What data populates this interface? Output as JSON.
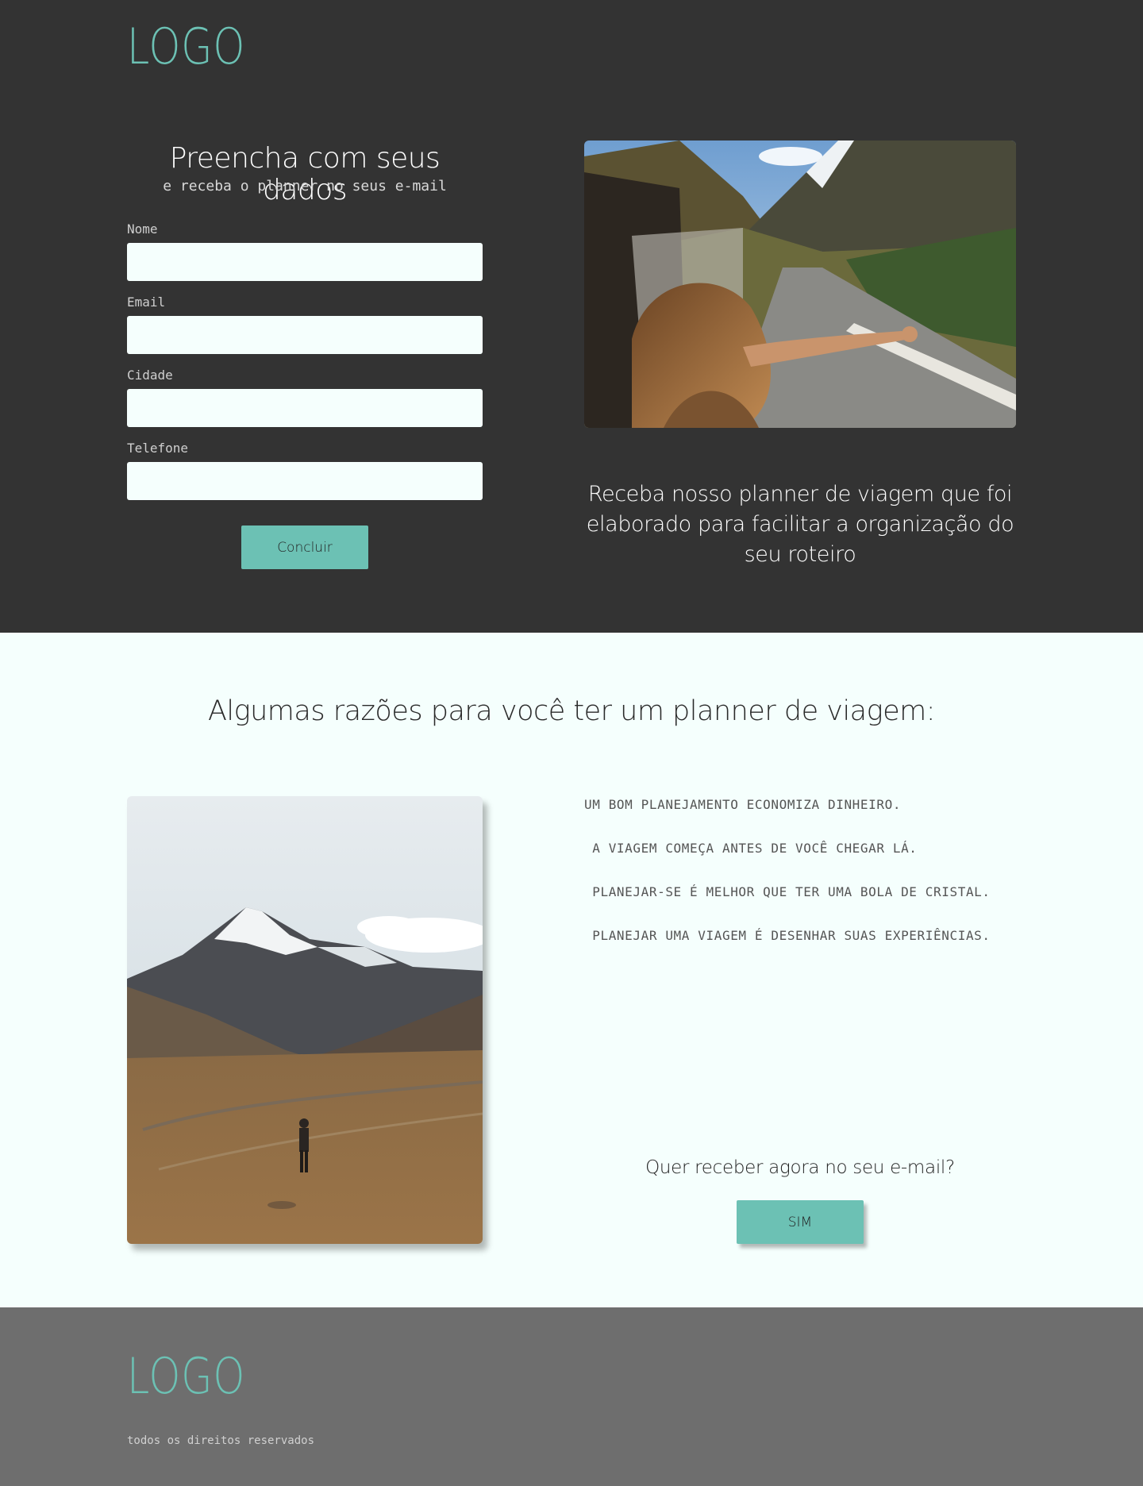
{
  "header": {
    "logo": "LOGO"
  },
  "form": {
    "title": "Preencha com seus dados",
    "subtitle": "e receba o planner no seus e-mail",
    "fields": [
      {
        "label": "Nome",
        "value": ""
      },
      {
        "label": "Email",
        "value": ""
      },
      {
        "label": "Cidade",
        "value": ""
      },
      {
        "label": "Telefone",
        "value": ""
      }
    ],
    "submit_label": "Concluir"
  },
  "hero": {
    "image_icon": "road-trip-photo",
    "promo_text": "Receba nosso planner de viagem que foi elaborado para facilitar a organização do seu roteiro"
  },
  "reasons_section": {
    "title": "Algumas razões para você ter um planner de viagem:",
    "image_icon": "mountain-hiker-photo",
    "items": [
      "UM BOM PLANEJAMENTO ECONOMIZA DINHEIRO.",
      " A VIAGEM COMEÇA ANTES DE VOCÊ CHEGAR LÁ.",
      " PLANEJAR-SE É MELHOR QUE TER UMA BOLA DE CRISTAL.",
      " PLANEJAR UMA VIAGEM É DESENHAR SUAS EXPERIÊNCIAS."
    ],
    "question": "Quer receber agora no seu e-mail?",
    "cta_label": "SIM"
  },
  "footer": {
    "logo": "LOGO",
    "copyright": "todos os direitos reservados"
  },
  "colors": {
    "accent": "#6cc1b4",
    "dark_bg": "#333333",
    "light_bg": "#f5fffd",
    "footer_bg": "#6e6e6e"
  }
}
